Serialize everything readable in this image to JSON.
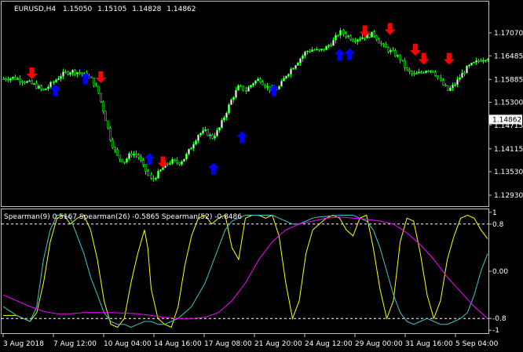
{
  "chart_data": [
    {
      "type": "candlestick",
      "header": {
        "symbol": "EURUSD,H4",
        "open": "1.15050",
        "high": "1.15105",
        "low": "1.14828",
        "close": "1.14862"
      },
      "y_ticks": [
        "1.17070",
        "1.16485",
        "1.15885",
        "1.15300",
        "1.14715",
        "1.14115",
        "1.13530",
        "1.12930"
      ],
      "ylim": [
        1.1265,
        1.1787
      ],
      "current_price": "1.14862",
      "colors": {
        "candle": "#00ff00",
        "candle_body": "#ffffff",
        "arrow_up": "#0000ff",
        "arrow_down": "#ff0000"
      },
      "price_path": [
        [
          0,
          1.159
        ],
        [
          3,
          1.1593
        ],
        [
          6,
          1.1585
        ],
        [
          9,
          1.1575
        ],
        [
          12,
          1.156
        ],
        [
          14,
          1.1575
        ],
        [
          17,
          1.16
        ],
        [
          20,
          1.161
        ],
        [
          23,
          1.1605
        ],
        [
          26,
          1.159
        ],
        [
          28,
          1.156
        ],
        [
          30,
          1.15
        ],
        [
          32,
          1.143
        ],
        [
          34,
          1.139
        ],
        [
          36,
          1.138
        ],
        [
          38,
          1.14
        ],
        [
          40,
          1.1395
        ],
        [
          42,
          1.136
        ],
        [
          44,
          1.133
        ],
        [
          46,
          1.135
        ],
        [
          48,
          1.137
        ],
        [
          50,
          1.138
        ],
        [
          52,
          1.1375
        ],
        [
          54,
          1.139
        ],
        [
          56,
          1.142
        ],
        [
          58,
          1.145
        ],
        [
          60,
          1.1455
        ],
        [
          62,
          1.144
        ],
        [
          64,
          1.146
        ],
        [
          66,
          1.15
        ],
        [
          68,
          1.154
        ],
        [
          70,
          1.157
        ],
        [
          72,
          1.156
        ],
        [
          74,
          1.158
        ],
        [
          76,
          1.159
        ],
        [
          78,
          1.157
        ],
        [
          80,
          1.156
        ],
        [
          82,
          1.157
        ],
        [
          84,
          1.16
        ],
        [
          86,
          1.162
        ],
        [
          88,
          1.164
        ],
        [
          90,
          1.166
        ],
        [
          92,
          1.1665
        ],
        [
          94,
          1.166
        ],
        [
          96,
          1.167
        ],
        [
          98,
          1.1685
        ],
        [
          100,
          1.171
        ],
        [
          102,
          1.17
        ],
        [
          104,
          1.169
        ],
        [
          106,
          1.1695
        ],
        [
          108,
          1.17
        ],
        [
          110,
          1.1705
        ],
        [
          112,
          1.168
        ],
        [
          114,
          1.1665
        ],
        [
          116,
          1.1655
        ],
        [
          118,
          1.164
        ],
        [
          120,
          1.161
        ],
        [
          122,
          1.16
        ],
        [
          124,
          1.1605
        ],
        [
          126,
          1.1615
        ],
        [
          128,
          1.161
        ],
        [
          130,
          1.158
        ],
        [
          132,
          1.156
        ],
        [
          134,
          1.1575
        ],
        [
          136,
          1.16
        ],
        [
          138,
          1.162
        ],
        [
          140,
          1.163
        ],
        [
          142,
          1.164
        ],
        [
          144,
          1.1645
        ]
      ],
      "arrows": [
        {
          "dir": "down",
          "x": 8.5,
          "price": 1.1605
        },
        {
          "dir": "up",
          "x": 15.5,
          "price": 1.156
        },
        {
          "dir": "up",
          "x": 24.5,
          "price": 1.159
        },
        {
          "dir": "down",
          "x": 29,
          "price": 1.1595
        },
        {
          "dir": "up",
          "x": 43.5,
          "price": 1.1385
        },
        {
          "dir": "down",
          "x": 47.5,
          "price": 1.1378
        },
        {
          "dir": "up",
          "x": 62.5,
          "price": 1.136
        },
        {
          "dir": "up",
          "x": 71,
          "price": 1.144
        },
        {
          "dir": "up",
          "x": 80.5,
          "price": 1.156
        },
        {
          "dir": "up",
          "x": 100,
          "price": 1.165
        },
        {
          "dir": "up",
          "x": 103,
          "price": 1.1652
        },
        {
          "dir": "down",
          "x": 107.5,
          "price": 1.1712
        },
        {
          "dir": "down",
          "x": 115,
          "price": 1.1718
        },
        {
          "dir": "down",
          "x": 122.5,
          "price": 1.1665
        },
        {
          "dir": "down",
          "x": 125,
          "price": 1.1642
        },
        {
          "dir": "down",
          "x": 132.5,
          "price": 1.1642
        }
      ]
    },
    {
      "type": "line",
      "header": "Spearman(9) 0.5167  Spearman(26) -0.5865  Spearman(52) -0.8486",
      "y_ticks": [
        "1",
        "0.8",
        "0.00",
        "-0.8",
        "-1"
      ],
      "ylim": [
        -1.05,
        1.05
      ],
      "levels": [
        0.8,
        -0.8
      ],
      "series": [
        {
          "name": "Spearman(9)",
          "color": "#ffff00",
          "points": [
            [
              0,
              -0.75
            ],
            [
              4,
              -0.75
            ],
            [
              8,
              -0.85
            ],
            [
              10,
              -0.7
            ],
            [
              12,
              -0.2
            ],
            [
              14,
              0.5
            ],
            [
              16,
              0.9
            ],
            [
              18,
              0.95
            ],
            [
              20,
              0.8
            ],
            [
              22,
              0.9
            ],
            [
              24,
              0.95
            ],
            [
              26,
              0.7
            ],
            [
              28,
              0.2
            ],
            [
              30,
              -0.5
            ],
            [
              32,
              -0.9
            ],
            [
              34,
              -0.95
            ],
            [
              36,
              -0.8
            ],
            [
              38,
              -0.2
            ],
            [
              40,
              0.3
            ],
            [
              42,
              0.7
            ],
            [
              43,
              0.4
            ],
            [
              44,
              -0.3
            ],
            [
              46,
              -0.8
            ],
            [
              48,
              -0.9
            ],
            [
              50,
              -0.95
            ],
            [
              52,
              -0.6
            ],
            [
              54,
              0.1
            ],
            [
              56,
              0.6
            ],
            [
              58,
              0.9
            ],
            [
              60,
              0.95
            ],
            [
              62,
              0.8
            ],
            [
              64,
              0.9
            ],
            [
              66,
              0.95
            ],
            [
              68,
              0.4
            ],
            [
              70,
              0.2
            ],
            [
              72,
              0.9
            ],
            [
              74,
              0.95
            ],
            [
              76,
              0.95
            ],
            [
              78,
              0.9
            ],
            [
              80,
              0.95
            ],
            [
              82,
              0.6
            ],
            [
              84,
              -0.2
            ],
            [
              86,
              -0.8
            ],
            [
              88,
              -0.5
            ],
            [
              90,
              0.3
            ],
            [
              92,
              0.7
            ],
            [
              94,
              0.8
            ],
            [
              96,
              0.9
            ],
            [
              98,
              0.95
            ],
            [
              100,
              0.9
            ],
            [
              102,
              0.7
            ],
            [
              104,
              0.6
            ],
            [
              106,
              0.9
            ],
            [
              108,
              0.95
            ],
            [
              110,
              0.4
            ],
            [
              112,
              -0.3
            ],
            [
              114,
              -0.8
            ],
            [
              116,
              -0.5
            ],
            [
              118,
              0.5
            ],
            [
              120,
              0.9
            ],
            [
              122,
              0.85
            ],
            [
              124,
              0.3
            ],
            [
              126,
              -0.4
            ],
            [
              128,
              -0.8
            ],
            [
              130,
              -0.5
            ],
            [
              132,
              0.2
            ],
            [
              134,
              0.6
            ],
            [
              136,
              0.9
            ],
            [
              138,
              0.95
            ],
            [
              140,
              0.9
            ],
            [
              142,
              0.7
            ],
            [
              144,
              0.55
            ]
          ]
        },
        {
          "name": "Spearman(26)",
          "color": "#3cc8c8",
          "points": [
            [
              0,
              -0.6
            ],
            [
              4,
              -0.75
            ],
            [
              8,
              -0.85
            ],
            [
              10,
              -0.6
            ],
            [
              12,
              0.2
            ],
            [
              14,
              0.7
            ],
            [
              16,
              0.95
            ],
            [
              18,
              0.95
            ],
            [
              20,
              0.9
            ],
            [
              22,
              0.6
            ],
            [
              24,
              0.3
            ],
            [
              26,
              -0.1
            ],
            [
              28,
              -0.4
            ],
            [
              30,
              -0.7
            ],
            [
              32,
              -0.85
            ],
            [
              34,
              -0.9
            ],
            [
              36,
              -0.9
            ],
            [
              38,
              -0.95
            ],
            [
              40,
              -0.9
            ],
            [
              42,
              -0.85
            ],
            [
              44,
              -0.85
            ],
            [
              46,
              -0.9
            ],
            [
              48,
              -0.9
            ],
            [
              50,
              -0.85
            ],
            [
              52,
              -0.8
            ],
            [
              54,
              -0.7
            ],
            [
              56,
              -0.6
            ],
            [
              58,
              -0.4
            ],
            [
              60,
              -0.2
            ],
            [
              62,
              0.1
            ],
            [
              64,
              0.4
            ],
            [
              66,
              0.7
            ],
            [
              68,
              0.85
            ],
            [
              70,
              0.9
            ],
            [
              72,
              0.95
            ],
            [
              74,
              0.95
            ],
            [
              76,
              0.95
            ],
            [
              78,
              0.95
            ],
            [
              80,
              0.95
            ],
            [
              82,
              0.9
            ],
            [
              84,
              0.85
            ],
            [
              86,
              0.8
            ],
            [
              88,
              0.8
            ],
            [
              90,
              0.85
            ],
            [
              92,
              0.9
            ],
            [
              94,
              0.92
            ],
            [
              96,
              0.93
            ],
            [
              98,
              0.94
            ],
            [
              100,
              0.95
            ],
            [
              102,
              0.95
            ],
            [
              104,
              0.95
            ],
            [
              106,
              0.9
            ],
            [
              108,
              0.85
            ],
            [
              110,
              0.7
            ],
            [
              112,
              0.4
            ],
            [
              114,
              0.0
            ],
            [
              116,
              -0.4
            ],
            [
              118,
              -0.7
            ],
            [
              120,
              -0.85
            ],
            [
              122,
              -0.9
            ],
            [
              124,
              -0.85
            ],
            [
              126,
              -0.8
            ],
            [
              128,
              -0.85
            ],
            [
              130,
              -0.9
            ],
            [
              132,
              -0.9
            ],
            [
              134,
              -0.85
            ],
            [
              136,
              -0.8
            ],
            [
              138,
              -0.7
            ],
            [
              140,
              -0.4
            ],
            [
              142,
              0.0
            ],
            [
              144,
              0.3
            ]
          ]
        },
        {
          "name": "Spearman(52)",
          "color": "#ff00ff",
          "points": [
            [
              0,
              -0.4
            ],
            [
              4,
              -0.5
            ],
            [
              8,
              -0.6
            ],
            [
              12,
              -0.68
            ],
            [
              16,
              -0.72
            ],
            [
              20,
              -0.72
            ],
            [
              24,
              -0.7
            ],
            [
              28,
              -0.7
            ],
            [
              32,
              -0.7
            ],
            [
              36,
              -0.71
            ],
            [
              40,
              -0.72
            ],
            [
              44,
              -0.75
            ],
            [
              48,
              -0.78
            ],
            [
              52,
              -0.8
            ],
            [
              56,
              -0.8
            ],
            [
              60,
              -0.78
            ],
            [
              64,
              -0.7
            ],
            [
              68,
              -0.5
            ],
            [
              72,
              -0.2
            ],
            [
              76,
              0.2
            ],
            [
              80,
              0.5
            ],
            [
              84,
              0.7
            ],
            [
              88,
              0.8
            ],
            [
              92,
              0.85
            ],
            [
              96,
              0.9
            ],
            [
              100,
              0.92
            ],
            [
              104,
              0.9
            ],
            [
              108,
              0.88
            ],
            [
              112,
              0.85
            ],
            [
              116,
              0.8
            ],
            [
              120,
              0.65
            ],
            [
              124,
              0.45
            ],
            [
              128,
              0.2
            ],
            [
              132,
              -0.1
            ],
            [
              136,
              -0.35
            ],
            [
              140,
              -0.6
            ],
            [
              144,
              -0.8
            ]
          ]
        }
      ]
    }
  ],
  "x_ticks": [
    "3 Aug 2018",
    "7 Aug 12:00",
    "10 Aug 04:00",
    "14 Aug 16:00",
    "17 Aug 08:00",
    "21 Aug 20:00",
    "24 Aug 12:00",
    "29 Aug 00:00",
    "31 Aug 16:00",
    "5 Sep 04:00"
  ]
}
